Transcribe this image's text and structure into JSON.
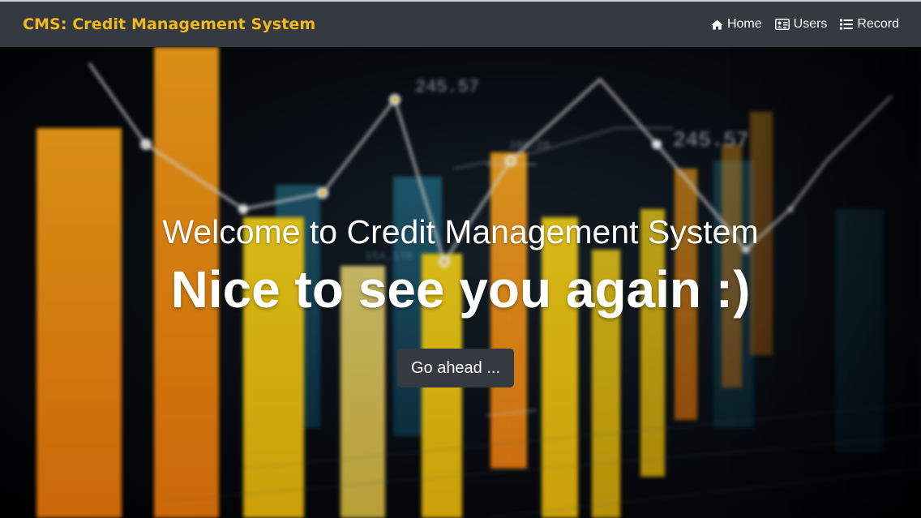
{
  "navbar": {
    "brand": "CMS: Credit Management System",
    "links": [
      {
        "label": "Home",
        "icon": "home-icon"
      },
      {
        "label": "Users",
        "icon": "id-card-icon"
      },
      {
        "label": "Record",
        "icon": "list-icon"
      }
    ]
  },
  "hero": {
    "welcome": "Welcome to Credit Management System",
    "tagline": "Nice to see you again :)",
    "cta_label": "Go ahead ...",
    "background_labels": [
      "245.57",
      "245.57",
      "289.28",
      "154,178"
    ]
  },
  "colors": {
    "navbar_bg": "#343a40",
    "brand": "#f3b81b",
    "button_bg": "#343a40",
    "bar_orange": "#f59a0c",
    "bar_yellow": "#f3c514",
    "bar_teal": "#1f6f8b"
  }
}
